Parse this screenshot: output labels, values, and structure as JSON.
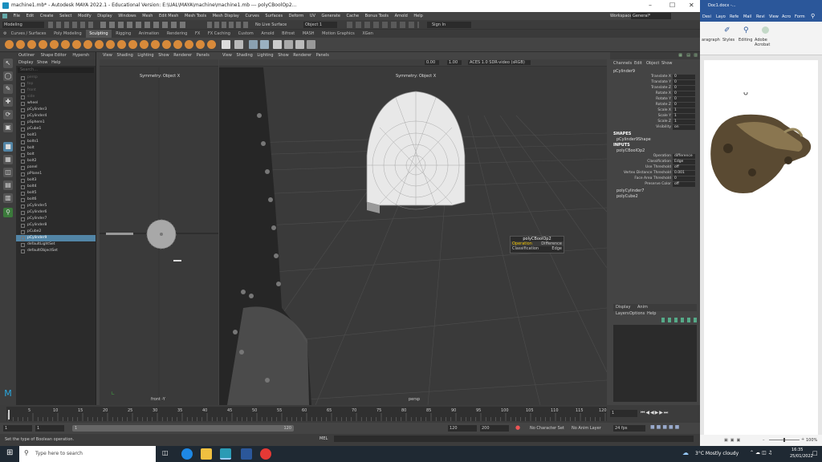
{
  "maya": {
    "title": "machine1.mb* - Autodesk MAYA 2022.1 - Educational Version: E:\\UAL\\MAYA\\machine\\machine1.mb   ---   polyCBoolOp2...",
    "menus": [
      "File",
      "Edit",
      "Create",
      "Select",
      "Modify",
      "Display",
      "Windows",
      "Mesh",
      "Edit Mesh",
      "Mesh Tools",
      "Mesh Display",
      "Curves",
      "Surfaces",
      "Deform",
      "UV",
      "Generate",
      "Cache",
      "Bonus Tools",
      "Arnold",
      "Help"
    ],
    "workspace_label": "Workspace :",
    "workspace_value": "General*",
    "mode": "Modeling",
    "live_surface": "No Live Surface",
    "object_field": "Object 1",
    "sign_in": "Sign In",
    "shelf_tabs": [
      "Curves / Surfaces",
      "Poly Modeling",
      "Sculpting",
      "Rigging",
      "Animation",
      "Rendering",
      "FX",
      "FX Caching",
      "Custom",
      "Arnold",
      "Bifrost",
      "MASH",
      "Motion Graphics",
      "XGen"
    ],
    "active_shelf": "Sculpting",
    "outliner": {
      "tabs": [
        "Outliner",
        "Shape Editor",
        "Hypersh"
      ],
      "menu": [
        "Display",
        "Show",
        "Help"
      ],
      "search": "Search...",
      "items": [
        {
          "name": "persp",
          "dim": true
        },
        {
          "name": "top",
          "dim": true
        },
        {
          "name": "front",
          "dim": true
        },
        {
          "name": "side",
          "dim": true
        },
        {
          "name": "wheel"
        },
        {
          "name": "pCylinder3"
        },
        {
          "name": "pCylinder4"
        },
        {
          "name": "pSphere1"
        },
        {
          "name": "pCube1"
        },
        {
          "name": "bolt1"
        },
        {
          "name": "bolts1"
        },
        {
          "name": "bolt"
        },
        {
          "name": "bolt"
        },
        {
          "name": "bolt2"
        },
        {
          "name": "panel"
        },
        {
          "name": "pPlane1"
        },
        {
          "name": "bolt3"
        },
        {
          "name": "bolt4"
        },
        {
          "name": "bolt5"
        },
        {
          "name": "bolt6"
        },
        {
          "name": "pCylinder5"
        },
        {
          "name": "pCylinder6"
        },
        {
          "name": "pCylinder7"
        },
        {
          "name": "pCylinder8"
        },
        {
          "name": "pCube2"
        },
        {
          "name": "pCylinder9",
          "selected": true
        },
        {
          "name": "defaultLightSet"
        },
        {
          "name": "defaultObjectSet"
        }
      ]
    },
    "viewport_menu": [
      "View",
      "Shading",
      "Lighting",
      "Show",
      "Renderer",
      "Panels"
    ],
    "vp1": {
      "label": "Symmetry: Object X",
      "bottom": "front -Y"
    },
    "vp2": {
      "label": "Symmetry: Object X",
      "bottom": "persp",
      "value1": "0.00",
      "value2": "1.00",
      "colorspace": "ACES 1.0 SDR-video (sRGB)"
    },
    "popup": {
      "title": "polyCBoolOp2",
      "rows": [
        {
          "label": "Operation",
          "value": "Difference"
        },
        {
          "label": "Classification",
          "value": "Edge"
        }
      ]
    },
    "channel": {
      "menu": [
        "Channels",
        "Edit",
        "Object",
        "Show"
      ],
      "object": "pCylinder9",
      "attrs": [
        {
          "label": "Translate X",
          "value": "0"
        },
        {
          "label": "Translate Y",
          "value": "0"
        },
        {
          "label": "Translate Z",
          "value": "0"
        },
        {
          "label": "Rotate X",
          "value": "0"
        },
        {
          "label": "Rotate Y",
          "value": "0"
        },
        {
          "label": "Rotate Z",
          "value": "0"
        },
        {
          "label": "Scale X",
          "value": "1"
        },
        {
          "label": "Scale Y",
          "value": "1"
        },
        {
          "label": "Scale Z",
          "value": "1"
        },
        {
          "label": "Visibility",
          "value": "on"
        }
      ],
      "shapes_header": "SHAPES",
      "shape": "pCylinder9Shape",
      "inputs_header": "INPUTS",
      "input": "polyCBoolOp2",
      "input_attrs": [
        {
          "label": "Operation",
          "value": "difference"
        },
        {
          "label": "Classification",
          "value": "Edge"
        },
        {
          "label": "Use Threshold",
          "value": "off"
        },
        {
          "label": "Vertex Distance Threshold",
          "value": "0.001"
        },
        {
          "label": "Face Area Threshold",
          "value": "0"
        },
        {
          "label": "Preserve Color",
          "value": "off"
        }
      ],
      "extra": [
        "polyCylinder7",
        "polyCube2"
      ]
    },
    "layers": {
      "tabs": [
        "Display",
        "Anim"
      ],
      "menu": [
        "Layers",
        "Options",
        "Help"
      ]
    },
    "timeline": {
      "ticks": [
        "5",
        "10",
        "15",
        "20",
        "25",
        "30",
        "35",
        "40",
        "45",
        "50",
        "55",
        "60",
        "65",
        "70",
        "75",
        "80",
        "85",
        "90",
        "95",
        "100",
        "105",
        "110",
        "115",
        "120"
      ],
      "current": "1"
    },
    "range": {
      "start": "1",
      "start2": "1",
      "end_inner": "120",
      "end": "120",
      "end2": "200",
      "character": "No Character Set",
      "anim_layer": "No Anim Layer",
      "fps": "24 fps"
    },
    "cmd": {
      "lang": "MEL"
    },
    "help": "Set the type of Boolean operation."
  },
  "word": {
    "title": "Doc1.docx -...",
    "tabs": [
      "Desi",
      "Layo",
      "Refe",
      "Mail",
      "Revi",
      "View",
      "Acro",
      "Form"
    ],
    "groups": [
      "aragraph",
      "Styles",
      "Editing",
      "Adobe Acrobat"
    ],
    "zoom": "100%"
  },
  "taskbar": {
    "search": "Type here to search",
    "weather": "3°C  Mostly cloudy",
    "time": "16:35",
    "date": "25/01/2022"
  }
}
